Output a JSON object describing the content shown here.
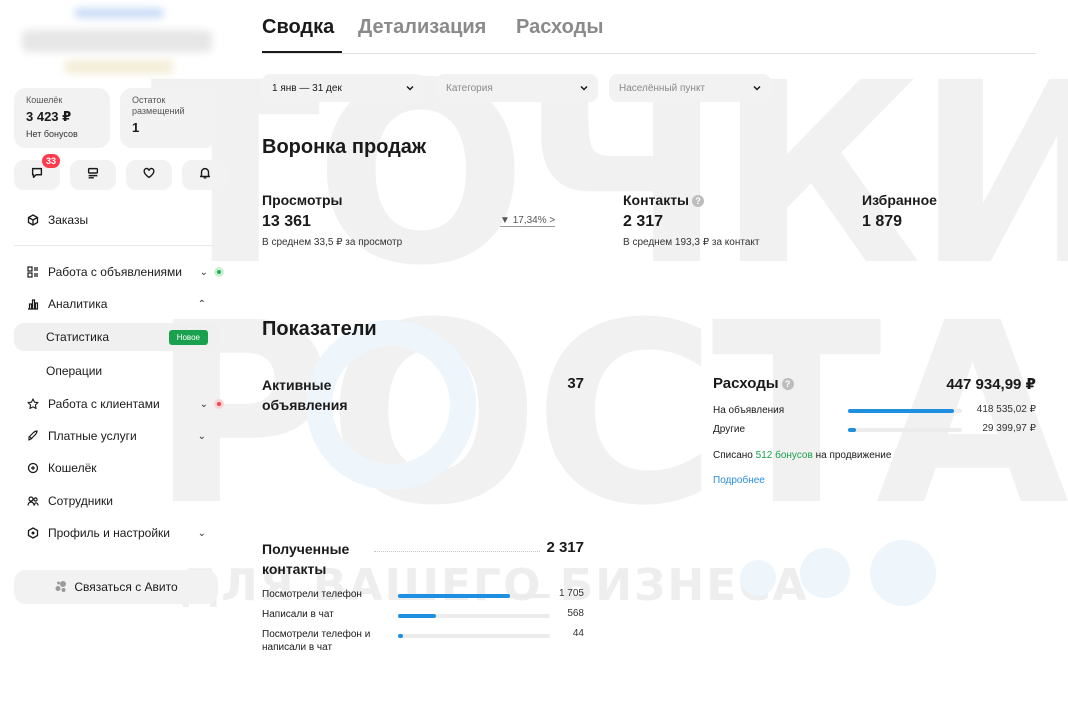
{
  "watermark": {
    "line1": "ТОЧКИ",
    "line2": "РОСТА",
    "line3": "ДЛЯ ВАШЕГО БИЗНЕСА"
  },
  "sidebar": {
    "wallet": {
      "label": "Кошелёк",
      "value": "3 423 ₽",
      "sub": "Нет бонусов"
    },
    "remaining": {
      "label": "Остаток размещений",
      "value": "1"
    },
    "icons": [
      {
        "icon": "chat-icon",
        "badge": "33"
      },
      {
        "icon": "listing-icon"
      },
      {
        "icon": "heart-icon"
      },
      {
        "icon": "bell-icon"
      }
    ],
    "nav": {
      "orders": "Заказы",
      "listings": "Работа с объявлениями",
      "analytics": "Аналитика",
      "statistics": "Статистика",
      "statistics_badge": "Новое",
      "operations": "Операции",
      "clients": "Работа с клиентами",
      "paid_services": "Платные услуги",
      "wallet": "Кошелёк",
      "employees": "Сотрудники",
      "profile": "Профиль и настройки"
    },
    "contact_button": "Связаться с Авито"
  },
  "tabs": [
    "Сводка",
    "Детализация",
    "Расходы"
  ],
  "filters": {
    "period": "1 янв — 31 дек",
    "category_placeholder": "Категория",
    "city_placeholder": "Населённый пункт"
  },
  "funnel": {
    "title": "Воронка продаж",
    "views": {
      "label": "Просмотры",
      "value": "13 361",
      "sub": "В среднем 33,5 ₽ за просмотр",
      "trend": "17,34% >"
    },
    "contacts": {
      "label": "Контакты",
      "value": "2 317",
      "sub": "В среднем 193,3 ₽ за контакт"
    },
    "favorites": {
      "label": "Избранное",
      "value": "1 879"
    }
  },
  "indicators": {
    "title": "Показатели",
    "active_listings": {
      "label": "Активные объявления",
      "value": "37"
    },
    "expenses": {
      "label": "Расходы",
      "value": "447 934,99 ₽",
      "rows": [
        {
          "label": "На объявления",
          "value": "418 535,02 ₽",
          "fraction": 0.934
        },
        {
          "label": "Другие",
          "value": "29 399,97 ₽",
          "fraction": 0.066
        }
      ],
      "bonus_prefix": "Списано",
      "bonus_amount": "512 бонусов",
      "bonus_suffix": "на продвижение",
      "more_link": "Подробнее"
    },
    "received_contacts": {
      "label": "Полученные контакты",
      "value": "2 317",
      "rows": [
        {
          "label": "Посмотрели телефон",
          "value": "1 705",
          "fraction": 0.736
        },
        {
          "label": "Написали в чат",
          "value": "568",
          "fraction": 0.245
        },
        {
          "label": "Посмотрели телефон и написали в чат",
          "value": "44",
          "fraction": 0.019
        }
      ]
    }
  }
}
